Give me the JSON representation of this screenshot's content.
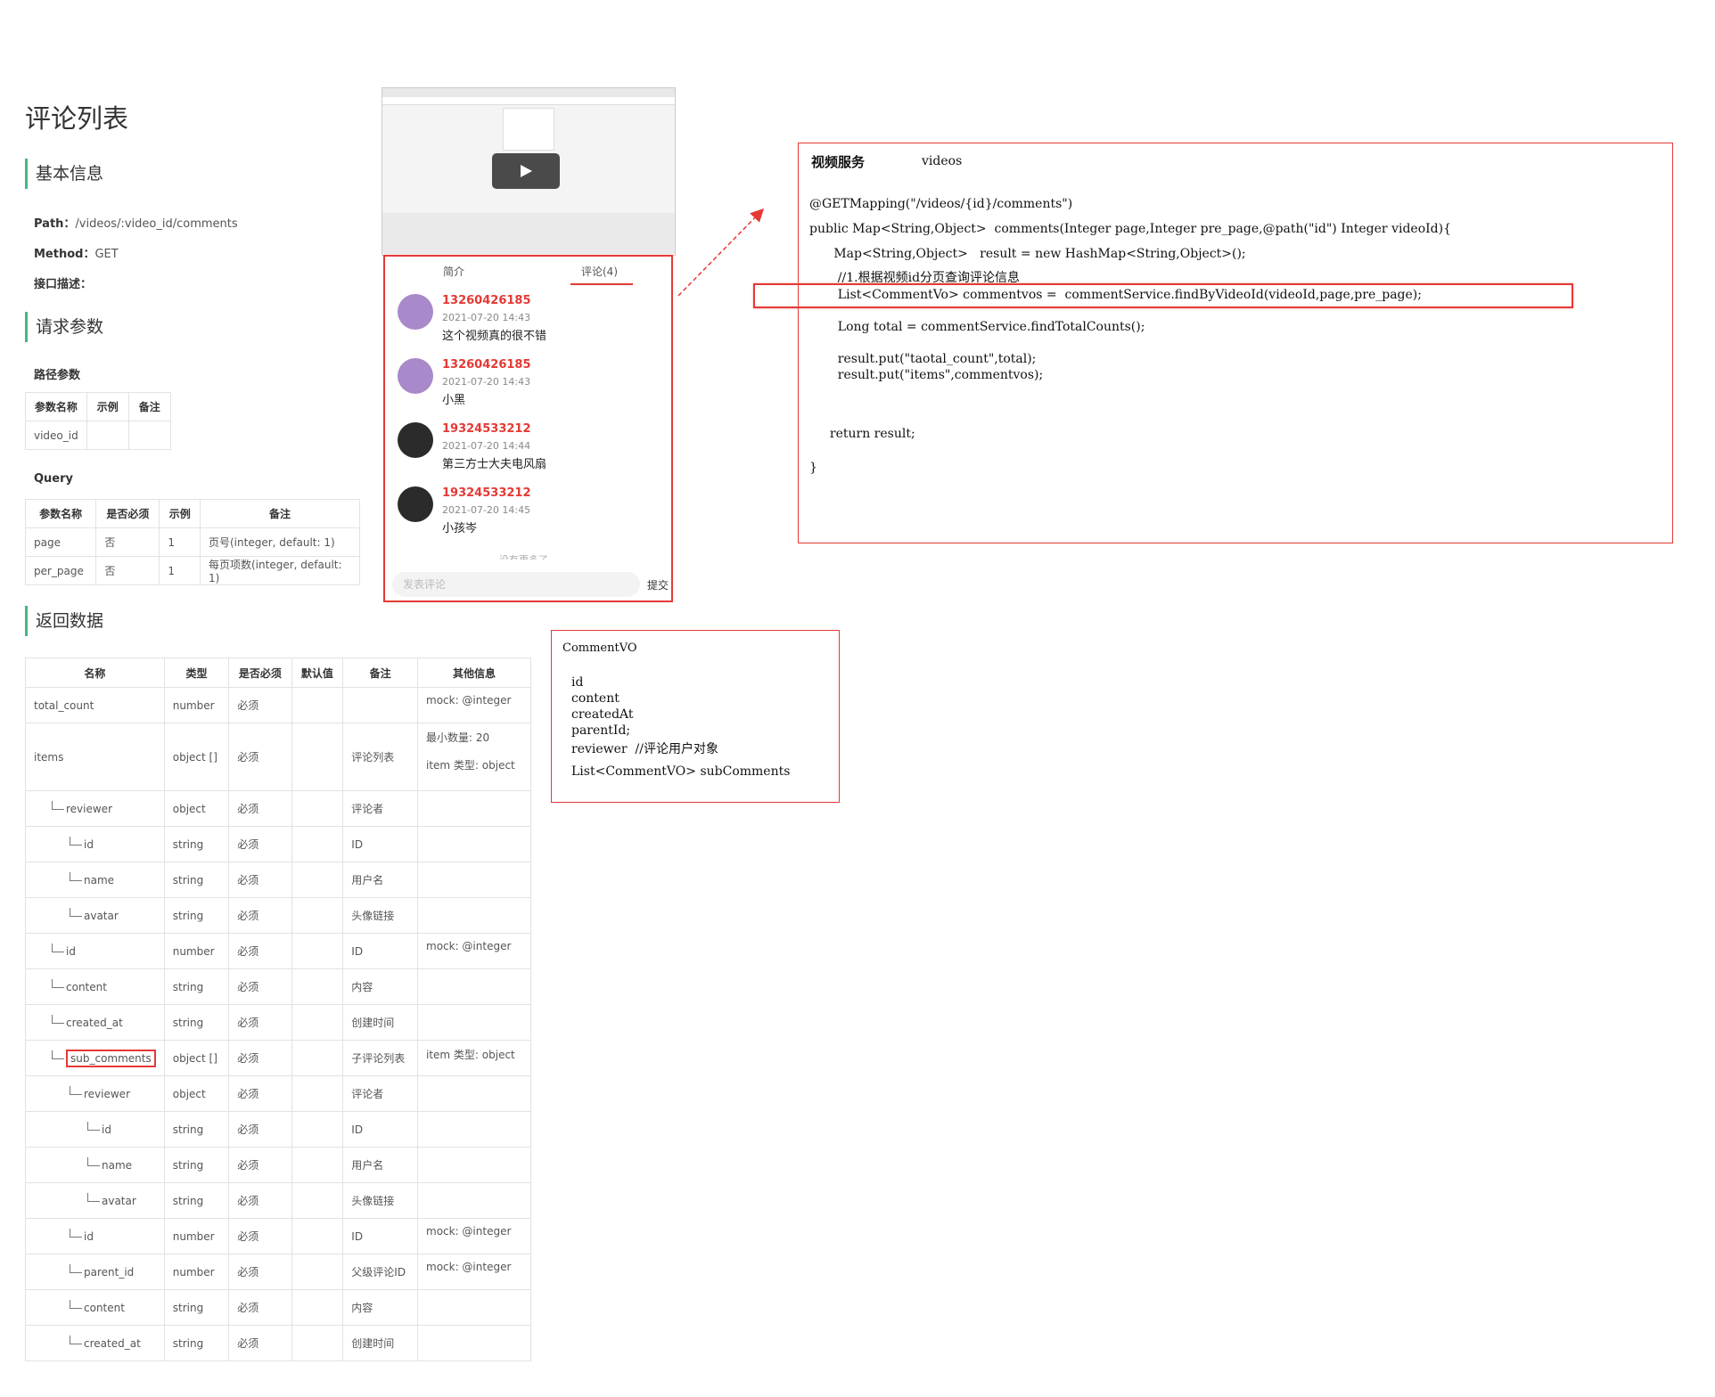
{
  "doc": {
    "title": "评论列表",
    "basic_info": "基本信息",
    "path_label": "Path：",
    "path_value": "/videos/:video_id/comments",
    "method_label": "Method：",
    "method_value": "GET",
    "desc_label": "接口描述：",
    "request_params": "请求参数",
    "path_params": "路径参数",
    "path_table": {
      "headers": [
        "参数名称",
        "示例",
        "备注"
      ],
      "rows": [
        [
          "video_id",
          "",
          ""
        ]
      ]
    },
    "query": "Query",
    "query_table": {
      "headers": [
        "参数名称",
        "是否必须",
        "示例",
        "备注"
      ],
      "rows": [
        [
          "page",
          "否",
          "1",
          "页号(integer, default: 1)"
        ],
        [
          "per_page",
          "否",
          "1",
          "每页项数(integer, default: 1)"
        ]
      ]
    },
    "return_data": "返回数据",
    "return_table": {
      "headers": [
        "名称",
        "类型",
        "是否必须",
        "默认值",
        "备注",
        "其他信息"
      ],
      "rows": [
        {
          "name": "total_count",
          "indent": 0,
          "type": "number",
          "required": "必须",
          "default": "",
          "note": "",
          "other": "mock: @integer",
          "other2": ""
        },
        {
          "name": "items",
          "indent": 0,
          "type": "object []",
          "required": "必须",
          "default": "",
          "note": "评论列表",
          "other": "最小数量: 20",
          "other2": "item 类型: object"
        },
        {
          "name": "reviewer",
          "indent": 1,
          "type": "object",
          "required": "必须",
          "default": "",
          "note": "评论者",
          "other": "",
          "other2": ""
        },
        {
          "name": "id",
          "indent": 2,
          "type": "string",
          "required": "必须",
          "default": "",
          "note": "ID",
          "other": "",
          "other2": ""
        },
        {
          "name": "name",
          "indent": 2,
          "type": "string",
          "required": "必须",
          "default": "",
          "note": "用户名",
          "other": "",
          "other2": ""
        },
        {
          "name": "avatar",
          "indent": 2,
          "type": "string",
          "required": "必须",
          "default": "",
          "note": "头像链接",
          "other": "",
          "other2": ""
        },
        {
          "name": "id",
          "indent": 1,
          "type": "number",
          "required": "必须",
          "default": "",
          "note": "ID",
          "other": "mock: @integer",
          "other2": ""
        },
        {
          "name": "content",
          "indent": 1,
          "type": "string",
          "required": "必须",
          "default": "",
          "note": "内容",
          "other": "",
          "other2": ""
        },
        {
          "name": "created_at",
          "indent": 1,
          "type": "string",
          "required": "必须",
          "default": "",
          "note": "创建时间",
          "other": "",
          "other2": ""
        },
        {
          "name": "sub_comments",
          "indent": 1,
          "type": "object []",
          "required": "必须",
          "default": "",
          "note": "子评论列表",
          "other": "item 类型: object",
          "other2": "",
          "highlight": true
        },
        {
          "name": "reviewer",
          "indent": 2,
          "type": "object",
          "required": "必须",
          "default": "",
          "note": "评论者",
          "other": "",
          "other2": ""
        },
        {
          "name": "id",
          "indent": 3,
          "type": "string",
          "required": "必须",
          "default": "",
          "note": "ID",
          "other": "",
          "other2": ""
        },
        {
          "name": "name",
          "indent": 3,
          "type": "string",
          "required": "必须",
          "default": "",
          "note": "用户名",
          "other": "",
          "other2": ""
        },
        {
          "name": "avatar",
          "indent": 3,
          "type": "string",
          "required": "必须",
          "default": "",
          "note": "头像链接",
          "other": "",
          "other2": ""
        },
        {
          "name": "id",
          "indent": 2,
          "type": "number",
          "required": "必须",
          "default": "",
          "note": "ID",
          "other": "mock: @integer",
          "other2": ""
        },
        {
          "name": "parent_id",
          "indent": 2,
          "type": "number",
          "required": "必须",
          "default": "",
          "note": "父级评论ID",
          "other": "mock: @integer",
          "other2": ""
        },
        {
          "name": "content",
          "indent": 2,
          "type": "string",
          "required": "必须",
          "default": "",
          "note": "内容",
          "other": "",
          "other2": ""
        },
        {
          "name": "created_at",
          "indent": 2,
          "type": "string",
          "required": "必须",
          "default": "",
          "note": "创建时间",
          "other": "",
          "other2": ""
        }
      ]
    }
  },
  "phone": {
    "tab_intro": "简介",
    "tab_comments": "评论(4)",
    "comments": [
      {
        "user": "13260426185",
        "time": "2021-07-20 14:43",
        "text": "这个视频真的很不错",
        "avatar_color": "#a889c9"
      },
      {
        "user": "13260426185",
        "time": "2021-07-20 14:43",
        "text": "小黑",
        "avatar_color": "#a889c9"
      },
      {
        "user": "19324533212",
        "time": "2021-07-20 14:44",
        "text": "第三方士大夫电风扇",
        "avatar_color": "#2b2b2b"
      },
      {
        "user": "19324533212",
        "time": "2021-07-20 14:45",
        "text": "小孩岑",
        "avatar_color": "#2b2b2b"
      }
    ],
    "no_more": "没有更多了",
    "input_placeholder": "发表评论",
    "submit": "提交"
  },
  "code": {
    "service_title": "视频服务",
    "service_name": "videos",
    "lines": [
      "@GETMapping(\"/videos/{id}/comments\")",
      "public Map<String,Object>  comments(Integer page,Integer pre_page,@path(\"id\") Integer videoId){",
      "   Map<String,Object>   result = new HashMap<String,Object>();",
      "    //1.根据视频id分页查询评论信息",
      "    List<CommentVo> commentvos =  commentService.findByVideoId(videoId,page,pre_page);",
      "    Long total = commentService.findTotalCounts();",
      "    result.put(\"taotal_count\",total);",
      "    result.put(\"items\",commentvos);",
      "  return result;",
      "}"
    ]
  },
  "vo": {
    "title": "CommentVO",
    "fields": [
      "id",
      "content",
      "createdAt",
      "parentId;",
      "reviewer  //评论用户对象",
      "List<CommentVO> subComments"
    ]
  },
  "colors": {
    "accent": "#42b983",
    "highlight": "#e53935"
  }
}
